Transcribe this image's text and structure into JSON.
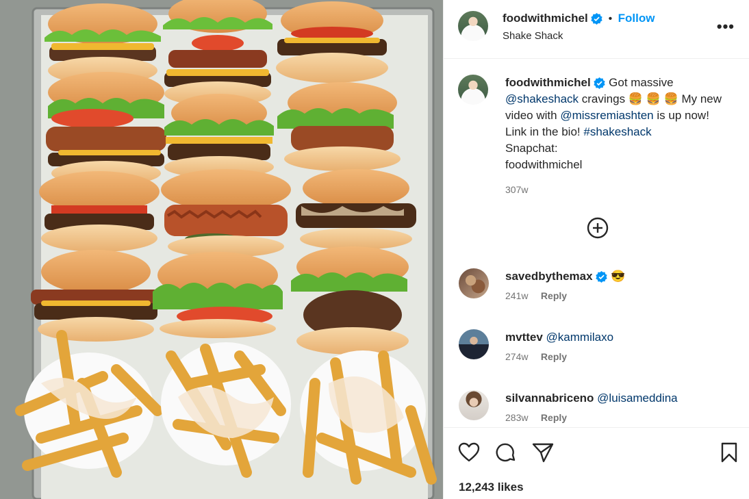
{
  "post": {
    "username": "foodwithmichel",
    "separator": "•",
    "follow_label": "Follow",
    "location": "Shake Shack",
    "more_glyph": "•••"
  },
  "caption": {
    "username": "foodwithmichel",
    "text_1": "Got massive",
    "mention_1": "@shakeshack",
    "text_2": "cravings 🍔 🍔 🍔 My new video with",
    "mention_2": "@missremiashten",
    "text_3": "is up now! Link in the bio!",
    "hashtag": "#shakeshack",
    "line_snap": "Snapchat:",
    "line_handle": "foodwithmichel",
    "time": "307w"
  },
  "comments": [
    {
      "username": "savedbythemax",
      "text": "😎",
      "time": "241w",
      "reply": "Reply"
    },
    {
      "username": "mvttev",
      "text": "@kammilaxo",
      "time": "274w",
      "reply": "Reply"
    },
    {
      "username": "silvannabriceno",
      "text": "@luisameddina",
      "time": "283w",
      "reply": "Reply"
    }
  ],
  "actions": {
    "likes": "12,243 likes"
  },
  "icons": {
    "verified": "verified-badge-icon",
    "more": "more-options-icon",
    "load_more": "plus-circle-icon",
    "like": "heart-icon",
    "comment": "comment-bubble-icon",
    "share": "send-paper-plane-icon",
    "save": "bookmark-icon"
  },
  "colors": {
    "accent": "#0095f6",
    "verified": "#0095f6",
    "link": "#00376b",
    "muted": "#737373"
  }
}
